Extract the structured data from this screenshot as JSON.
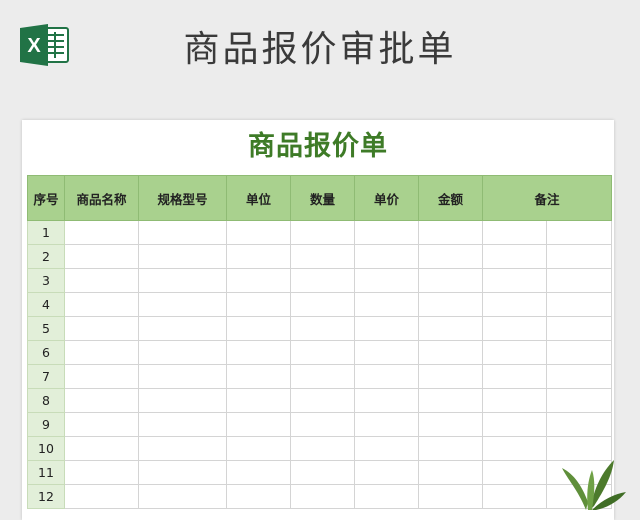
{
  "page": {
    "banner_title": "商品报价审批单",
    "sheet_title": "商品报价单",
    "logo_icon": "excel-icon",
    "logo_letter": "X",
    "accent_color": "#3e7b27",
    "header_fill": "#a9d18e",
    "number_fill": "#e2efd9"
  },
  "table": {
    "headers": [
      "序号",
      "商品名称",
      "规格型号",
      "单位",
      "数量",
      "单价",
      "金额",
      "备注"
    ],
    "row_numbers": [
      "1",
      "2",
      "3",
      "4",
      "5",
      "6",
      "7",
      "8",
      "9",
      "10",
      "11",
      "12"
    ]
  }
}
